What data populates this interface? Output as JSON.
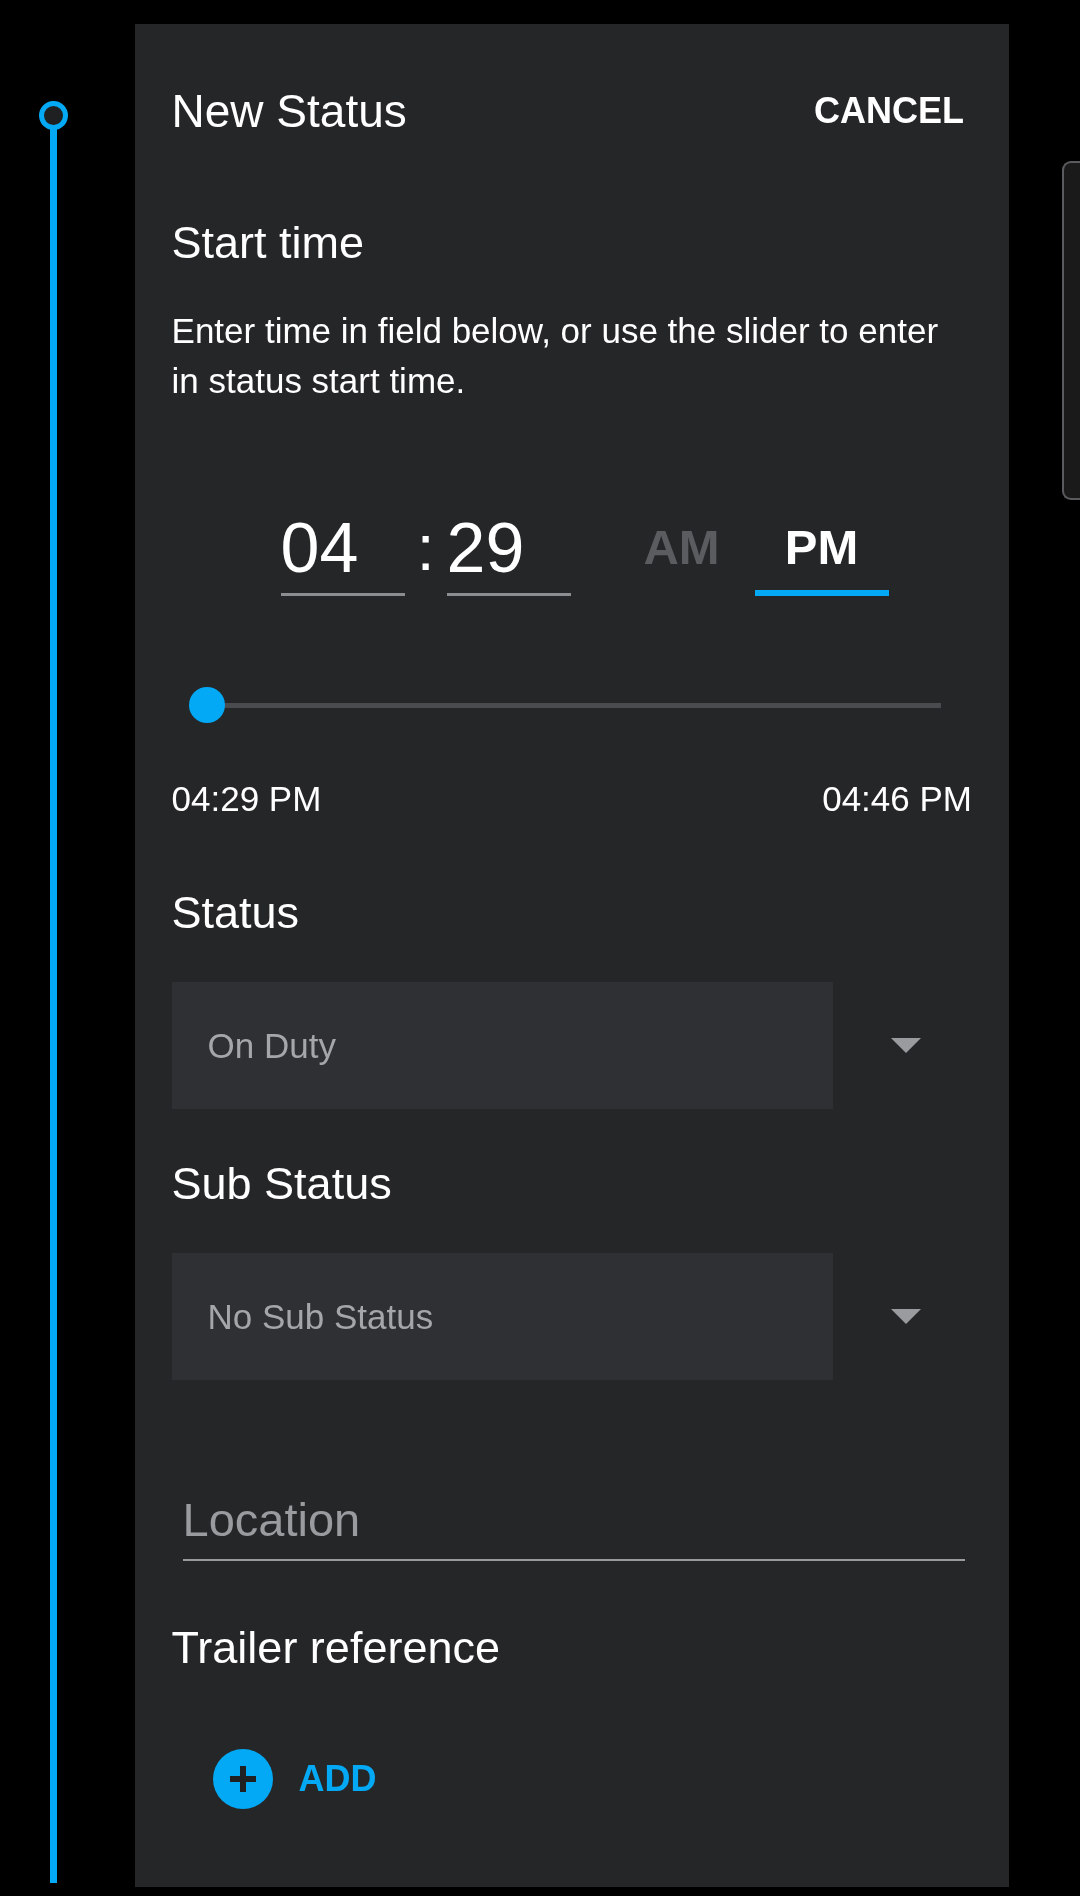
{
  "dialog": {
    "title": "New Status",
    "cancel_button": "CANCEL"
  },
  "start_time": {
    "heading": "Start time",
    "hint": "Enter time in field below, or use the slider to enter in status start time.",
    "hour": "04",
    "separator": ":",
    "minute": "29",
    "periods": [
      {
        "label": "AM",
        "selected": false
      },
      {
        "label": "PM",
        "selected": true
      }
    ],
    "slider": {
      "level": 0
    },
    "range_start": "04:29 PM",
    "range_end": "04:46 PM"
  },
  "status": {
    "label": "Status",
    "value": "On Duty"
  },
  "sub_status": {
    "label": "Sub Status",
    "value": "No Sub Status"
  },
  "location": {
    "placeholder": "Location"
  },
  "trailer_reference": {
    "label": "Trailer reference",
    "add_button": "ADD"
  }
}
